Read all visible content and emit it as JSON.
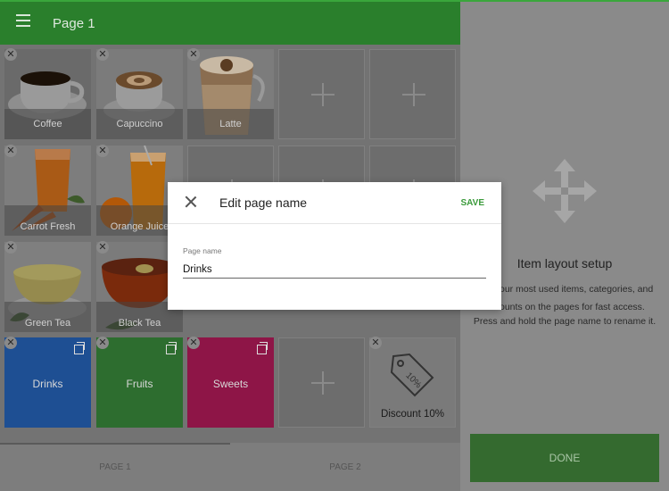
{
  "header": {
    "title": "Page 1",
    "menu_icon": "hamburger-icon"
  },
  "items": [
    {
      "label": "Coffee",
      "image": "coffee-cup-image"
    },
    {
      "label": "Capuccino",
      "image": "cappuccino-image"
    },
    {
      "label": "Latte",
      "image": "latte-image"
    },
    {
      "label": "Carrot Fresh",
      "image": "carrot-juice-image"
    },
    {
      "label": "Orange Juice",
      "image": "orange-juice-image"
    },
    {
      "label": "Green Tea",
      "image": "green-tea-image"
    },
    {
      "label": "Black Tea",
      "image": "black-tea-image"
    }
  ],
  "categories": [
    {
      "label": "Drinks",
      "color": "#1e4f93"
    },
    {
      "label": "Fruits",
      "color": "#2d6d2f"
    },
    {
      "label": "Sweets",
      "color": "#8e1547"
    }
  ],
  "discount": {
    "label": "Discount 10%",
    "tag_text": "10%"
  },
  "remove_glyph": "✕",
  "tabs": [
    {
      "label": "PAGE 1"
    },
    {
      "label": "PAGE 2"
    }
  ],
  "side_panel": {
    "heading": "Item layout setup",
    "line1": "our most used items, categories, and",
    "line2": "ounts on the pages for fast access.",
    "line3": "Press and hold the page name to rename it.",
    "done_label": "DONE"
  },
  "dialog": {
    "title": "Edit page name",
    "save_label": "SAVE",
    "field_label": "Page name",
    "field_value": "Drinks"
  },
  "colors": {
    "accent": "#3aa63c",
    "header": "#2a7f2c"
  }
}
